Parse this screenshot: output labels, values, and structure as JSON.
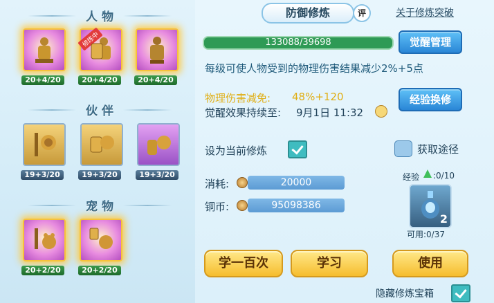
{
  "left": {
    "sections": {
      "people": "人物",
      "partners": "伙伴",
      "pets": "宠物"
    },
    "people": [
      {
        "level": "20+4/20",
        "active": false
      },
      {
        "level": "20+4/20",
        "active": true,
        "ribbon": "修炼中"
      },
      {
        "level": "20+4/20",
        "active": false
      }
    ],
    "partners": [
      {
        "level": "19+3/20"
      },
      {
        "level": "19+3/20"
      },
      {
        "level": "19+3/20"
      }
    ],
    "pets": [
      {
        "level": "20+2/20"
      },
      {
        "level": "20+2/20"
      }
    ]
  },
  "header": {
    "title": "防御修炼",
    "badge": "评",
    "link": "关于修炼突破"
  },
  "progress": {
    "text": "133088/39698"
  },
  "buttons": {
    "awaken": "觉醒管理",
    "exchange": "经验换修",
    "study100": "学一百次",
    "study": "学习",
    "use": "使用",
    "obtain": "获取途径"
  },
  "desc": "每级可使人物受到的物理伤害结果减少2%+5点",
  "stats": {
    "reduction_label": "物理伤害减免:",
    "reduction_value": "48%+120",
    "duration_label": "觉醒效果持续至:",
    "duration_value": "9月1日 11:32"
  },
  "set_current": "设为当前修炼",
  "cost": {
    "label": "消耗:",
    "value": "20000"
  },
  "copper": {
    "label": "铜币:",
    "value": "95098386"
  },
  "item": {
    "exp_label": "经验",
    "exp_value": ":0/10",
    "count": "2",
    "available": "可用:0/37"
  },
  "hide_box": "隐藏修炼宝箱",
  "colors": {
    "accent_blue": "#2a86d6",
    "gold": "#f6bd2e",
    "progress_green": "#2e9a55"
  }
}
